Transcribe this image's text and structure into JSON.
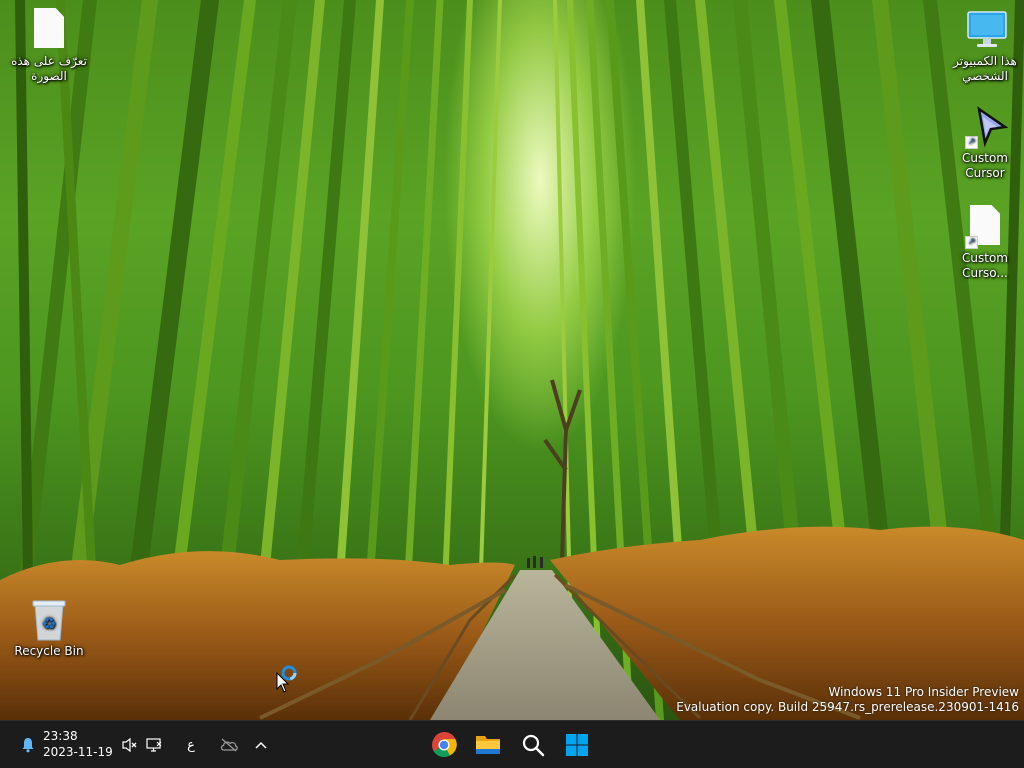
{
  "desktop": {
    "icons": [
      {
        "label": "تعرّف على هذه الصورة",
        "icon": "document-icon"
      },
      {
        "label": "Recycle Bin",
        "icon": "recycle-bin-icon"
      },
      {
        "label": "هذا الكمبيوتر الشخصي",
        "icon": "this-pc-icon"
      },
      {
        "label": "Custom Cursor",
        "icon": "custom-cursor-icon"
      },
      {
        "label": "Custom Curso...",
        "icon": "document-shortcut-icon"
      }
    ],
    "watermark": {
      "line1": "Windows 11 Pro Insider Preview",
      "line2": "Evaluation copy. Build 25947.rs_prerelease.230901-1416"
    }
  },
  "taskbar": {
    "clock": {
      "time": "23:38",
      "date": "2023-11-19"
    },
    "input_language": "ع",
    "pinned": [
      "chrome-icon",
      "file-explorer-icon",
      "search-icon",
      "start-icon"
    ],
    "accent": "#00a4ef",
    "background": "#1c1c1c"
  }
}
